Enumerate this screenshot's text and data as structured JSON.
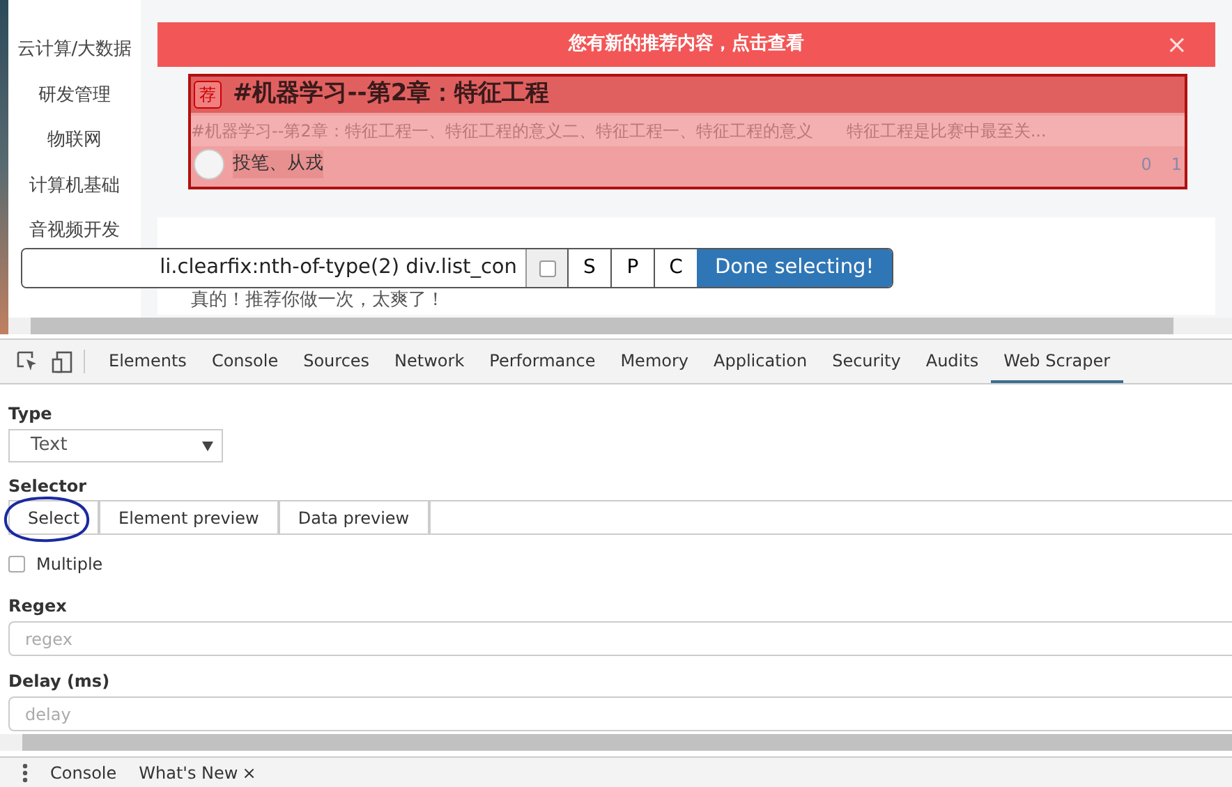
{
  "page": {
    "sidebar": [
      {
        "label": "云计算/大数据"
      },
      {
        "label": "研发管理"
      },
      {
        "label": "物联网"
      },
      {
        "label": "计算机基础"
      },
      {
        "label": "音视频开发"
      }
    ],
    "banner": {
      "text": "您有新的推荐内容，点击查看",
      "close": "×"
    },
    "article": {
      "highlighted": true,
      "badge": "荐",
      "title": "#机器学习--第2章：特征工程",
      "summary": "#机器学习--第2章：特征工程一、特征工程的意义二、特征工程一、特征工程的意义　　特征工程是比赛中最至关...",
      "author": "投笔、从戎",
      "likes": "0",
      "comments": "1"
    },
    "next_article": {
      "summary": "真的！推荐你做一次，太爽了！"
    }
  },
  "selector_toolbar": {
    "selector": "li.clearfix:nth-of-type(2) div.list_con",
    "multiple": false,
    "buttons": [
      "S",
      "P",
      "C"
    ],
    "done": "Done selecting!"
  },
  "devtools": {
    "tabs": [
      {
        "label": "Elements",
        "selected": false
      },
      {
        "label": "Console",
        "selected": false
      },
      {
        "label": "Sources",
        "selected": false
      },
      {
        "label": "Network",
        "selected": false
      },
      {
        "label": "Performance",
        "selected": false
      },
      {
        "label": "Memory",
        "selected": false
      },
      {
        "label": "Application",
        "selected": false
      },
      {
        "label": "Security",
        "selected": false
      },
      {
        "label": "Audits",
        "selected": false
      },
      {
        "label": "Web Scraper",
        "selected": true
      }
    ],
    "form": {
      "type_label": "Type",
      "type_value": "Text",
      "selector_label": "Selector",
      "selector_buttons": [
        "Select",
        "Element preview",
        "Data preview"
      ],
      "multiple": {
        "label": "Multiple",
        "checked": false
      },
      "regex": {
        "label": "Regex",
        "placeholder": "regex"
      },
      "delay": {
        "label": "Delay (ms)",
        "placeholder": "delay"
      }
    }
  },
  "drawer": {
    "tabs": [
      {
        "label": "Console"
      },
      {
        "label": "What's New",
        "close": "×"
      }
    ]
  }
}
